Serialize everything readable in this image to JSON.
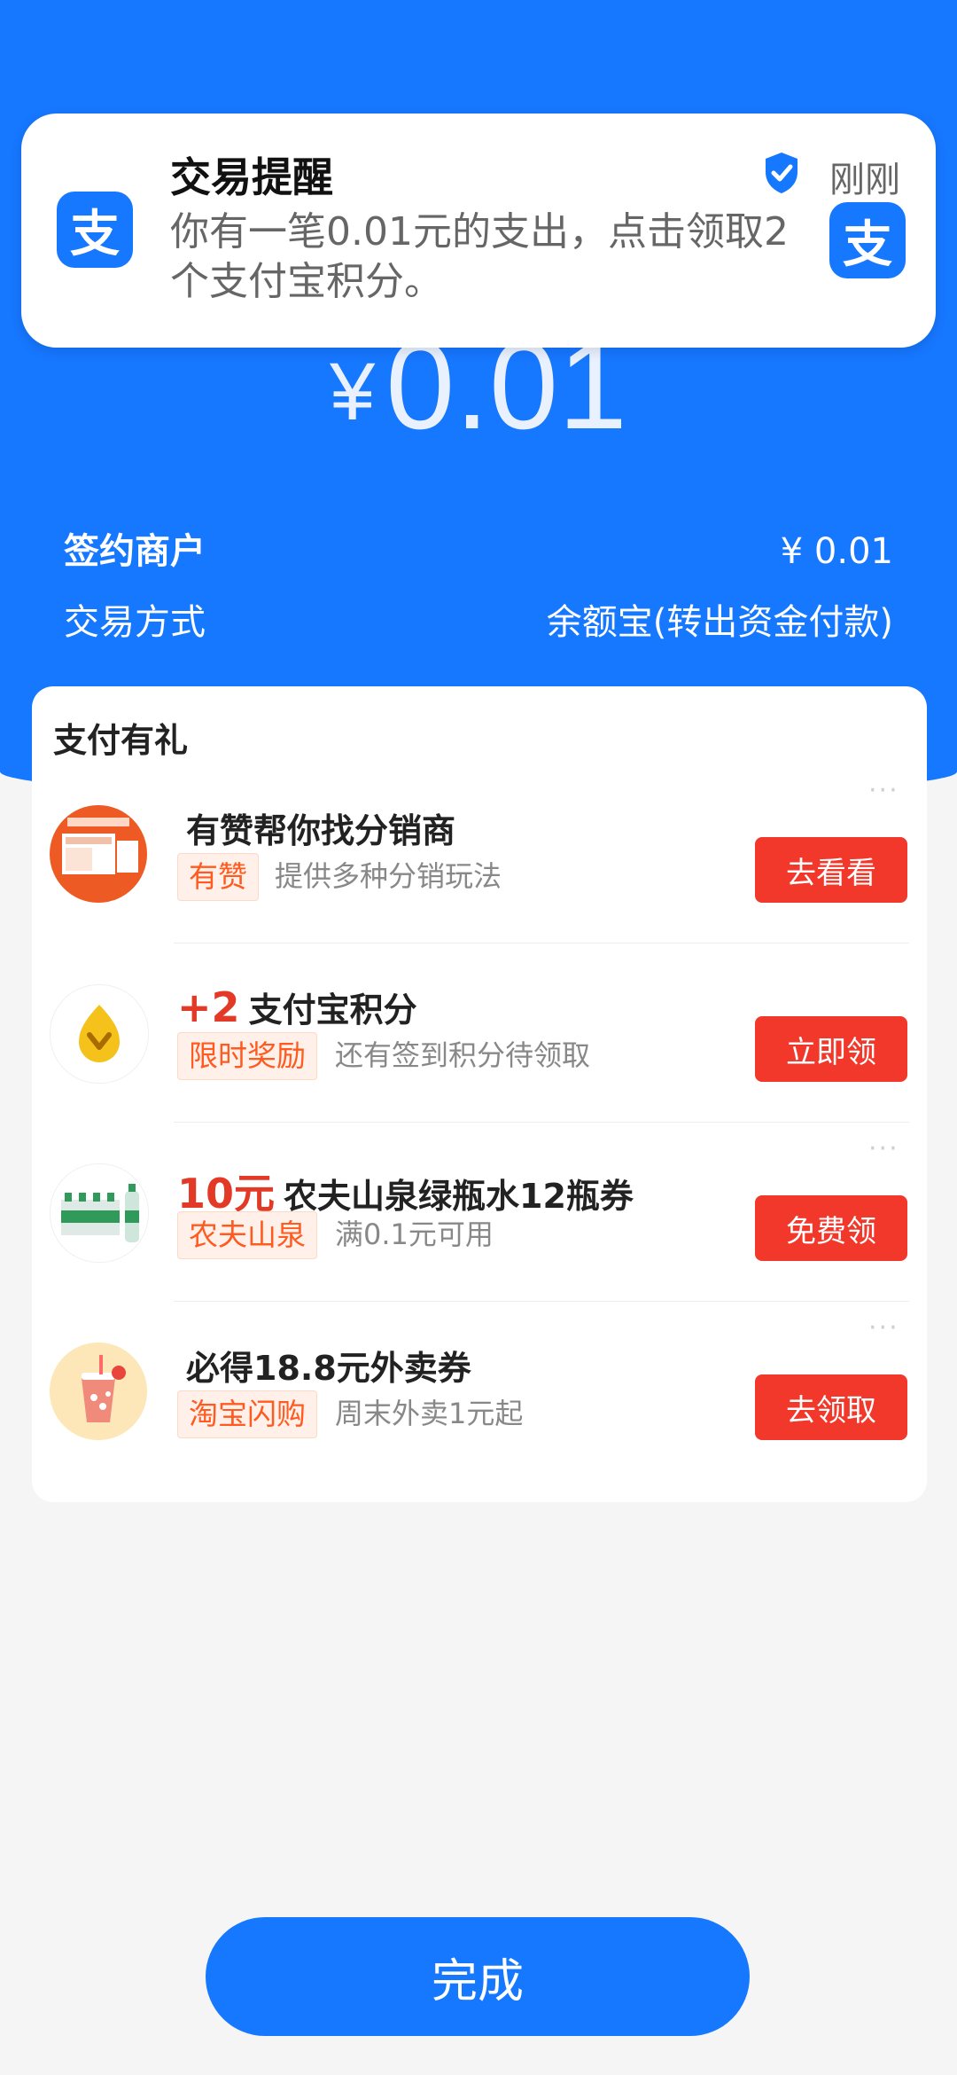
{
  "notification": {
    "title": "交易提醒",
    "body": "你有一笔0.01元的支出，点击领取2个支付宝积分。",
    "time": "刚刚",
    "app_icon": "支"
  },
  "payment": {
    "currency": "¥",
    "amount": "0.01",
    "merchant_label": "签约商户",
    "merchant_value": "¥ 0.01",
    "method_label": "交易方式",
    "method_value": "余额宝(转出资金付款)"
  },
  "rewards": {
    "title": "支付有礼",
    "items": [
      {
        "highlight": "",
        "title": "有赞帮你找分销商",
        "tag": "有赞",
        "desc": "提供多种分销玩法",
        "cta": "去看看"
      },
      {
        "highlight": "+2",
        "title": "支付宝积分",
        "tag": "限时奖励",
        "desc": "还有签到积分待领取",
        "cta": "立即领"
      },
      {
        "highlight": "10元",
        "title": "农夫山泉绿瓶水12瓶券",
        "tag": "农夫山泉",
        "desc": "满0.1元可用",
        "cta": "免费领"
      },
      {
        "highlight": "",
        "title": "必得18.8元外卖券",
        "tag": "淘宝闪购",
        "desc": "周末外卖1元起",
        "cta": "去领取"
      }
    ]
  },
  "done_label": "完成",
  "colors": {
    "brand_blue": "#1677ff",
    "cta_red": "#f2372b",
    "highlight_red": "#e33a28",
    "tag_orange": "#ff5a1f"
  }
}
